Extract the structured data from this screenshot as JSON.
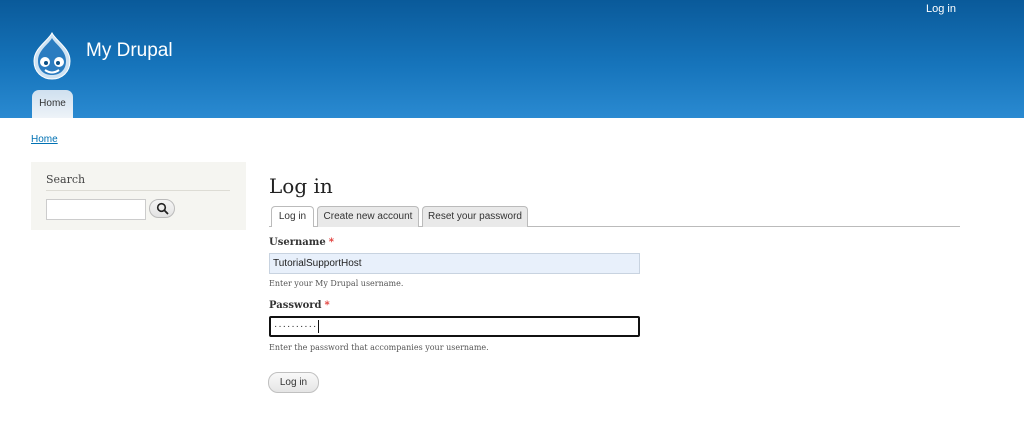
{
  "header": {
    "secondary_menu": {
      "login_link": "Log in"
    },
    "site_name": "My Drupal",
    "main_menu": [
      {
        "label": "Home"
      }
    ]
  },
  "breadcrumb": {
    "home": "Home"
  },
  "sidebar": {
    "search_block": {
      "title": "Search",
      "input_value": "",
      "button_icon": "search-icon"
    }
  },
  "content": {
    "title": "Log in",
    "tabs": [
      {
        "label": "Log in",
        "active": true
      },
      {
        "label": "Create new account",
        "active": false
      },
      {
        "label": "Reset your password",
        "active": false
      }
    ],
    "form": {
      "username": {
        "label": "Username",
        "required_marker": "*",
        "value": "TutorialSupportHost",
        "description": "Enter your My Drupal username."
      },
      "password": {
        "label": "Password",
        "required_marker": "*",
        "masked_value": "··········",
        "description": "Enter the password that accompanies your username."
      },
      "submit_label": "Log in"
    }
  },
  "colors": {
    "header_top": "#0a5a9a",
    "header_bottom": "#2a8ad1",
    "link": "#0071b3",
    "required": "#e0322e"
  }
}
